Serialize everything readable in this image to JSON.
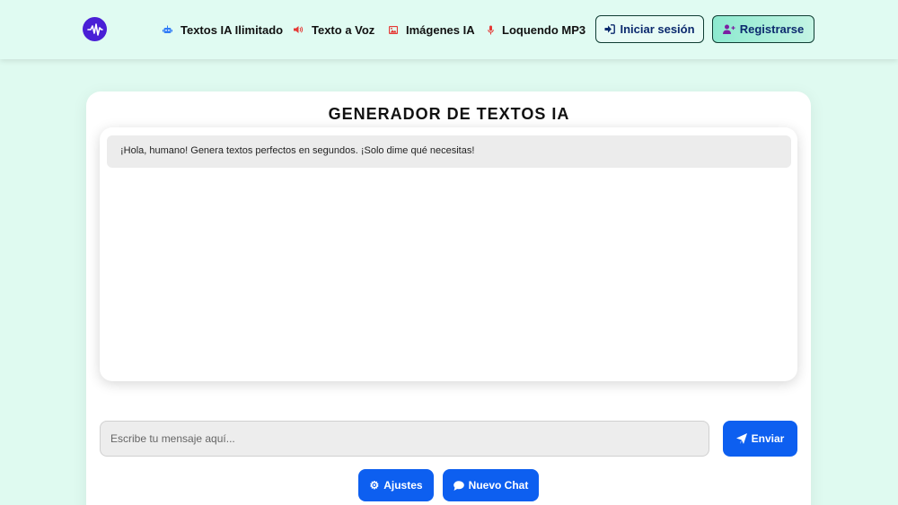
{
  "nav": {
    "links": [
      {
        "label": "Textos IA Ilimitado",
        "icon": "robot-icon",
        "icon_color": "#2f7cf6"
      },
      {
        "label": "Texto a Voz",
        "icon": "speaker-icon",
        "icon_color": "#e53935"
      },
      {
        "label": "Imágenes IA",
        "icon": "image-icon",
        "icon_color": "#e53935"
      },
      {
        "label": "Loquendo MP3",
        "icon": "microphone-icon",
        "icon_color": "#e53935"
      }
    ],
    "login_label": "Iniciar sesión",
    "register_label": "Registrarse"
  },
  "main": {
    "title": "GENERADOR DE TEXTOS IA",
    "messages": [
      {
        "role": "bot",
        "text": "¡Hola, humano! Genera textos perfectos en segundos. ¡Solo dime qué necesitas!"
      }
    ],
    "input": {
      "value": "",
      "placeholder": "Escribe tu mensaje aquí..."
    },
    "send_label": "Enviar",
    "settings_label": "Ajustes",
    "new_chat_label": "Nuevo Chat"
  },
  "colors": {
    "accent": "#0d5ff0",
    "brand": "#4a1fd6",
    "background": "#dffaf0"
  }
}
